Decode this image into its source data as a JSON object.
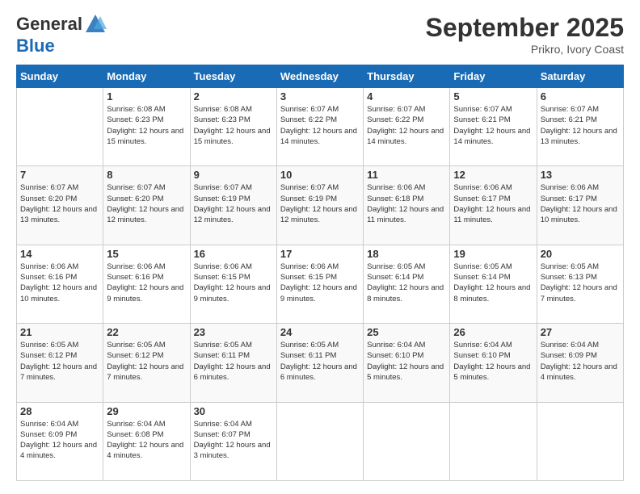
{
  "header": {
    "logo_general": "General",
    "logo_blue": "Blue",
    "month_title": "September 2025",
    "location": "Prikro, Ivory Coast"
  },
  "days_of_week": [
    "Sunday",
    "Monday",
    "Tuesday",
    "Wednesday",
    "Thursday",
    "Friday",
    "Saturday"
  ],
  "weeks": [
    [
      {
        "day": "",
        "sunrise": "",
        "sunset": "",
        "daylight": ""
      },
      {
        "day": "1",
        "sunrise": "Sunrise: 6:08 AM",
        "sunset": "Sunset: 6:23 PM",
        "daylight": "Daylight: 12 hours and 15 minutes."
      },
      {
        "day": "2",
        "sunrise": "Sunrise: 6:08 AM",
        "sunset": "Sunset: 6:23 PM",
        "daylight": "Daylight: 12 hours and 15 minutes."
      },
      {
        "day": "3",
        "sunrise": "Sunrise: 6:07 AM",
        "sunset": "Sunset: 6:22 PM",
        "daylight": "Daylight: 12 hours and 14 minutes."
      },
      {
        "day": "4",
        "sunrise": "Sunrise: 6:07 AM",
        "sunset": "Sunset: 6:22 PM",
        "daylight": "Daylight: 12 hours and 14 minutes."
      },
      {
        "day": "5",
        "sunrise": "Sunrise: 6:07 AM",
        "sunset": "Sunset: 6:21 PM",
        "daylight": "Daylight: 12 hours and 14 minutes."
      },
      {
        "day": "6",
        "sunrise": "Sunrise: 6:07 AM",
        "sunset": "Sunset: 6:21 PM",
        "daylight": "Daylight: 12 hours and 13 minutes."
      }
    ],
    [
      {
        "day": "7",
        "sunrise": "Sunrise: 6:07 AM",
        "sunset": "Sunset: 6:20 PM",
        "daylight": "Daylight: 12 hours and 13 minutes."
      },
      {
        "day": "8",
        "sunrise": "Sunrise: 6:07 AM",
        "sunset": "Sunset: 6:20 PM",
        "daylight": "Daylight: 12 hours and 12 minutes."
      },
      {
        "day": "9",
        "sunrise": "Sunrise: 6:07 AM",
        "sunset": "Sunset: 6:19 PM",
        "daylight": "Daylight: 12 hours and 12 minutes."
      },
      {
        "day": "10",
        "sunrise": "Sunrise: 6:07 AM",
        "sunset": "Sunset: 6:19 PM",
        "daylight": "Daylight: 12 hours and 12 minutes."
      },
      {
        "day": "11",
        "sunrise": "Sunrise: 6:06 AM",
        "sunset": "Sunset: 6:18 PM",
        "daylight": "Daylight: 12 hours and 11 minutes."
      },
      {
        "day": "12",
        "sunrise": "Sunrise: 6:06 AM",
        "sunset": "Sunset: 6:17 PM",
        "daylight": "Daylight: 12 hours and 11 minutes."
      },
      {
        "day": "13",
        "sunrise": "Sunrise: 6:06 AM",
        "sunset": "Sunset: 6:17 PM",
        "daylight": "Daylight: 12 hours and 10 minutes."
      }
    ],
    [
      {
        "day": "14",
        "sunrise": "Sunrise: 6:06 AM",
        "sunset": "Sunset: 6:16 PM",
        "daylight": "Daylight: 12 hours and 10 minutes."
      },
      {
        "day": "15",
        "sunrise": "Sunrise: 6:06 AM",
        "sunset": "Sunset: 6:16 PM",
        "daylight": "Daylight: 12 hours and 9 minutes."
      },
      {
        "day": "16",
        "sunrise": "Sunrise: 6:06 AM",
        "sunset": "Sunset: 6:15 PM",
        "daylight": "Daylight: 12 hours and 9 minutes."
      },
      {
        "day": "17",
        "sunrise": "Sunrise: 6:06 AM",
        "sunset": "Sunset: 6:15 PM",
        "daylight": "Daylight: 12 hours and 9 minutes."
      },
      {
        "day": "18",
        "sunrise": "Sunrise: 6:05 AM",
        "sunset": "Sunset: 6:14 PM",
        "daylight": "Daylight: 12 hours and 8 minutes."
      },
      {
        "day": "19",
        "sunrise": "Sunrise: 6:05 AM",
        "sunset": "Sunset: 6:14 PM",
        "daylight": "Daylight: 12 hours and 8 minutes."
      },
      {
        "day": "20",
        "sunrise": "Sunrise: 6:05 AM",
        "sunset": "Sunset: 6:13 PM",
        "daylight": "Daylight: 12 hours and 7 minutes."
      }
    ],
    [
      {
        "day": "21",
        "sunrise": "Sunrise: 6:05 AM",
        "sunset": "Sunset: 6:12 PM",
        "daylight": "Daylight: 12 hours and 7 minutes."
      },
      {
        "day": "22",
        "sunrise": "Sunrise: 6:05 AM",
        "sunset": "Sunset: 6:12 PM",
        "daylight": "Daylight: 12 hours and 7 minutes."
      },
      {
        "day": "23",
        "sunrise": "Sunrise: 6:05 AM",
        "sunset": "Sunset: 6:11 PM",
        "daylight": "Daylight: 12 hours and 6 minutes."
      },
      {
        "day": "24",
        "sunrise": "Sunrise: 6:05 AM",
        "sunset": "Sunset: 6:11 PM",
        "daylight": "Daylight: 12 hours and 6 minutes."
      },
      {
        "day": "25",
        "sunrise": "Sunrise: 6:04 AM",
        "sunset": "Sunset: 6:10 PM",
        "daylight": "Daylight: 12 hours and 5 minutes."
      },
      {
        "day": "26",
        "sunrise": "Sunrise: 6:04 AM",
        "sunset": "Sunset: 6:10 PM",
        "daylight": "Daylight: 12 hours and 5 minutes."
      },
      {
        "day": "27",
        "sunrise": "Sunrise: 6:04 AM",
        "sunset": "Sunset: 6:09 PM",
        "daylight": "Daylight: 12 hours and 4 minutes."
      }
    ],
    [
      {
        "day": "28",
        "sunrise": "Sunrise: 6:04 AM",
        "sunset": "Sunset: 6:09 PM",
        "daylight": "Daylight: 12 hours and 4 minutes."
      },
      {
        "day": "29",
        "sunrise": "Sunrise: 6:04 AM",
        "sunset": "Sunset: 6:08 PM",
        "daylight": "Daylight: 12 hours and 4 minutes."
      },
      {
        "day": "30",
        "sunrise": "Sunrise: 6:04 AM",
        "sunset": "Sunset: 6:07 PM",
        "daylight": "Daylight: 12 hours and 3 minutes."
      },
      {
        "day": "",
        "sunrise": "",
        "sunset": "",
        "daylight": ""
      },
      {
        "day": "",
        "sunrise": "",
        "sunset": "",
        "daylight": ""
      },
      {
        "day": "",
        "sunrise": "",
        "sunset": "",
        "daylight": ""
      },
      {
        "day": "",
        "sunrise": "",
        "sunset": "",
        "daylight": ""
      }
    ]
  ]
}
